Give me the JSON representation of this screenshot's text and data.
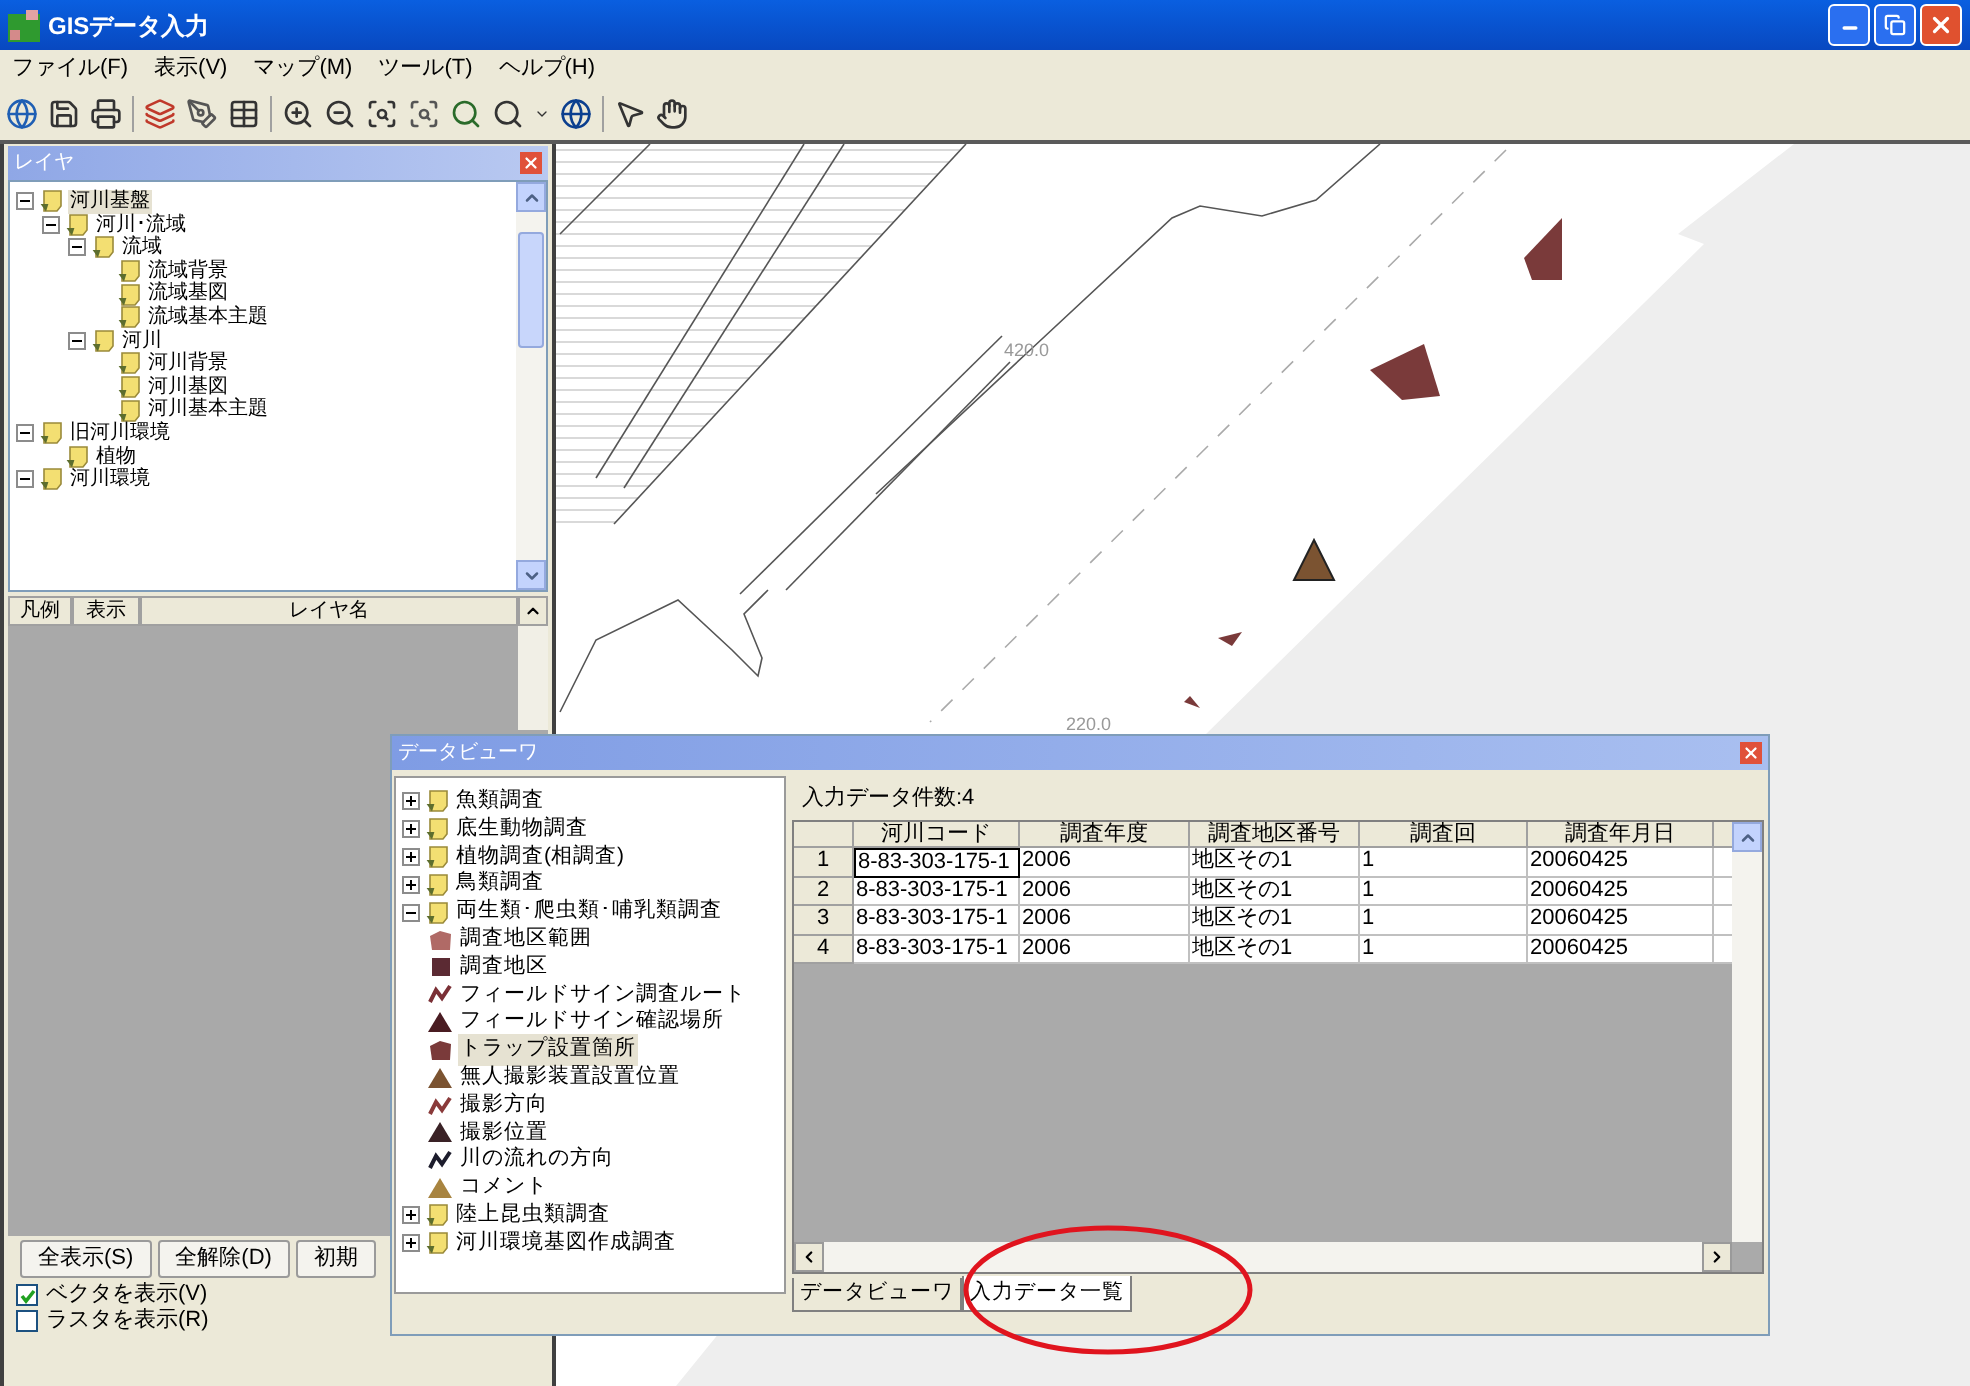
{
  "window": {
    "title": "GISデータ入力"
  },
  "menu": [
    "ファイル(F)",
    "表示(V)",
    "マップ(M)",
    "ツール(T)",
    "ヘルプ(H)"
  ],
  "layer_panel": {
    "title": "レイヤ",
    "tree": [
      {
        "label": "河川基盤",
        "expanded": true,
        "selected": true,
        "children": [
          {
            "label": "河川･流域",
            "expanded": true,
            "selected": false,
            "children": [
              {
                "label": "流域",
                "expanded": true,
                "selected": false,
                "children": [
                  {
                    "label": "流域背景",
                    "selected": false
                  },
                  {
                    "label": "流域基図",
                    "selected": false
                  },
                  {
                    "label": "流域基本主題",
                    "selected": false
                  }
                ]
              },
              {
                "label": "河川",
                "expanded": true,
                "selected": false,
                "children": [
                  {
                    "label": "河川背景",
                    "selected": false
                  },
                  {
                    "label": "河川基図",
                    "selected": false
                  },
                  {
                    "label": "河川基本主題",
                    "selected": false
                  }
                ]
              }
            ]
          }
        ]
      },
      {
        "label": "旧河川環境",
        "expanded": true,
        "selected": false,
        "children": [
          {
            "label": "植物",
            "selected": false
          }
        ]
      },
      {
        "label": "河川環境",
        "expanded": true,
        "selected": false
      }
    ],
    "legend_columns": [
      "凡例",
      "表示",
      "レイヤ名"
    ],
    "buttons": [
      "全表示(S)",
      "全解除(D)",
      "初期"
    ],
    "options": [
      {
        "label": "ベクタを表示(V)",
        "checked": true
      },
      {
        "label": "ラスタを表示(R)",
        "checked": false
      }
    ]
  },
  "map": {
    "labels": [
      "420.0",
      "220.0"
    ]
  },
  "data_viewer": {
    "title": "データビューワ",
    "tree": [
      {
        "kind": "folder",
        "label": "魚類調査",
        "expanded": false,
        "selected": false
      },
      {
        "kind": "folder",
        "label": "底生動物調査",
        "expanded": false,
        "selected": false
      },
      {
        "kind": "folder",
        "label": "植物調査(相調査)",
        "expanded": false,
        "selected": false
      },
      {
        "kind": "folder",
        "label": "鳥類調査",
        "expanded": false,
        "selected": false
      },
      {
        "kind": "folder",
        "label": "両生類･爬虫類･哺乳類調査",
        "expanded": true,
        "selected": false,
        "children": [
          {
            "kind": "polygon",
            "label": "調査地区範囲",
            "color": "#b06a66",
            "selected": false
          },
          {
            "kind": "square",
            "label": "調査地区",
            "color": "#5b2a33",
            "selected": false
          },
          {
            "kind": "line",
            "label": "フィールドサイン調査ルート",
            "color": "#7a2f35",
            "selected": false
          },
          {
            "kind": "triangle",
            "label": "フィールドサイン確認場所",
            "color": "#4a1c22",
            "selected": false
          },
          {
            "kind": "polygon",
            "label": "トラップ設置箇所",
            "color": "#7a3a3a",
            "selected": true
          },
          {
            "kind": "triangle",
            "label": "無人撮影装置設置位置",
            "color": "#7b5331",
            "selected": false
          },
          {
            "kind": "line",
            "label": "撮影方向",
            "color": "#8a3a3a",
            "selected": false
          },
          {
            "kind": "triangle",
            "label": "撮影位置",
            "color": "#3a2226",
            "selected": false
          },
          {
            "kind": "line",
            "label": "川の流れの方向",
            "color": "#1c1c2c",
            "selected": false
          },
          {
            "kind": "triangle",
            "label": "コメント",
            "color": "#a88440",
            "selected": false
          }
        ]
      },
      {
        "kind": "folder",
        "label": "陸上昆虫類調査",
        "expanded": false,
        "selected": false
      },
      {
        "kind": "folder",
        "label": "河川環境基図作成調査",
        "expanded": false,
        "selected": false
      }
    ],
    "count_label": "入力データ件数:4",
    "table": {
      "columns": [
        "河川コード",
        "調査年度",
        "調査地区番号",
        "調査回",
        "調査年月日"
      ],
      "rows": [
        {
          "number": "1",
          "focused": true,
          "cells": [
            "8-83-303-175-1",
            "2006",
            "地区その1",
            "1",
            "20060425"
          ]
        },
        {
          "number": "2",
          "focused": false,
          "cells": [
            "8-83-303-175-1",
            "2006",
            "地区その1",
            "1",
            "20060425"
          ]
        },
        {
          "number": "3",
          "focused": false,
          "cells": [
            "8-83-303-175-1",
            "2006",
            "地区その1",
            "1",
            "20060425"
          ]
        },
        {
          "number": "4",
          "focused": false,
          "cells": [
            "8-83-303-175-1",
            "2006",
            "地区その1",
            "1",
            "20060425"
          ]
        }
      ]
    },
    "tabs": [
      {
        "label": "データビューワ",
        "selected": false
      },
      {
        "label": "入力データ一覧",
        "selected": true
      }
    ]
  }
}
